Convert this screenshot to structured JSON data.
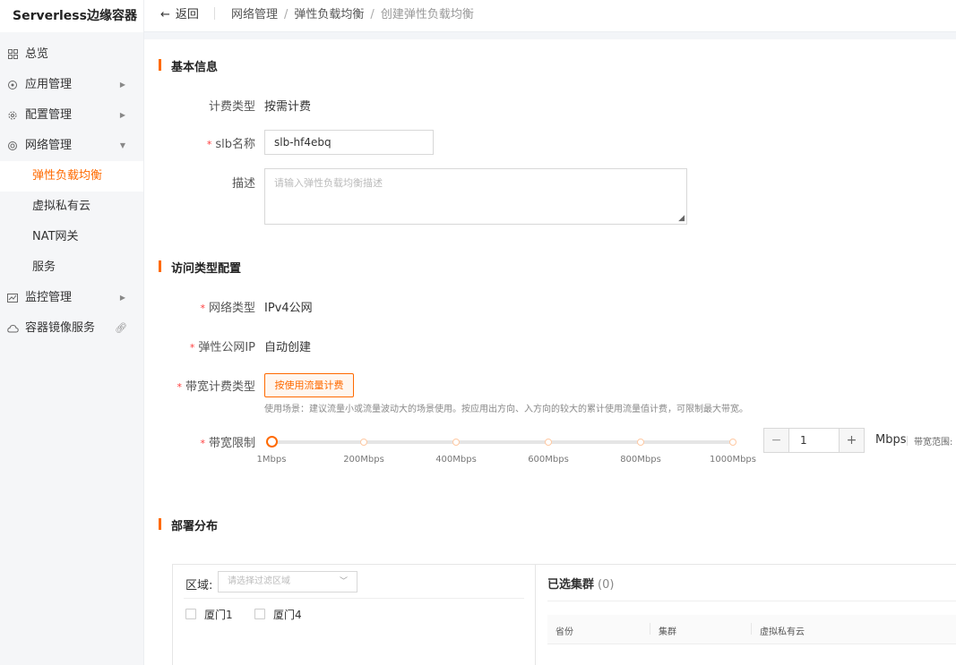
{
  "app": {
    "title": "Serverless边缘容器"
  },
  "sidebar": {
    "items": [
      {
        "label": "总览",
        "icon": "grid-icon"
      },
      {
        "label": "应用管理",
        "icon": "apps-icon",
        "expand": "right"
      },
      {
        "label": "配置管理",
        "icon": "gear-icon",
        "expand": "right"
      },
      {
        "label": "网络管理",
        "icon": "network-icon",
        "expand": "down"
      },
      {
        "label": "弹性负载均衡",
        "active": true
      },
      {
        "label": "虚拟私有云"
      },
      {
        "label": "NAT网关"
      },
      {
        "label": "服务"
      },
      {
        "label": "监控管理",
        "icon": "monitor-icon",
        "expand": "right"
      },
      {
        "label": "容器镜像服务",
        "icon": "cloud-icon",
        "extra": "link-icon"
      }
    ]
  },
  "topbar": {
    "back_label": "返回",
    "breadcrumb": [
      "网络管理",
      "弹性负载均衡",
      "创建弹性负载均衡"
    ],
    "sep": "/"
  },
  "basic": {
    "title": "基本信息",
    "billing_label": "计费类型",
    "billing_value": "按需计费",
    "name_label": "slb名称",
    "name_value": "slb-hf4ebq",
    "desc_label": "描述",
    "desc_placeholder": "请输入弹性负载均衡描述"
  },
  "access": {
    "title": "访问类型配置",
    "nettype_label": "网络类型",
    "nettype_value": "IPv4公网",
    "eip_label": "弹性公网IP",
    "eip_value": "自动创建",
    "bwbill_label": "带宽计费类型",
    "bwbill_option": "按使用流量计费",
    "hint": "使用场景：建议流量小或流量波动大的场景使用。按应用出方向、入方向的较大的累计使用流量值计费，可限制最大带宽。",
    "bwlimit_label": "带宽限制",
    "slider": {
      "min": 1,
      "max": 1000,
      "value": 1,
      "marks": [
        "1Mbps",
        "200Mbps",
        "400Mbps",
        "600Mbps",
        "800Mbps",
        "1000Mbps"
      ]
    },
    "stepper": {
      "value": "1",
      "minus": "−",
      "plus": "+"
    },
    "unit": "Mbps",
    "range_text": "带宽范围:"
  },
  "deploy": {
    "title": "部署分布",
    "region_label": "区域:",
    "region_placeholder": "请选择过滤区域",
    "regions": [
      "厦门1",
      "厦门4"
    ],
    "selected_title": "已选集群",
    "selected_count": "(0)",
    "columns": [
      "省份",
      "集群",
      "虚拟私有云"
    ]
  },
  "colors": {
    "accent": "#ff6a00",
    "required": "#ff3b3b"
  }
}
